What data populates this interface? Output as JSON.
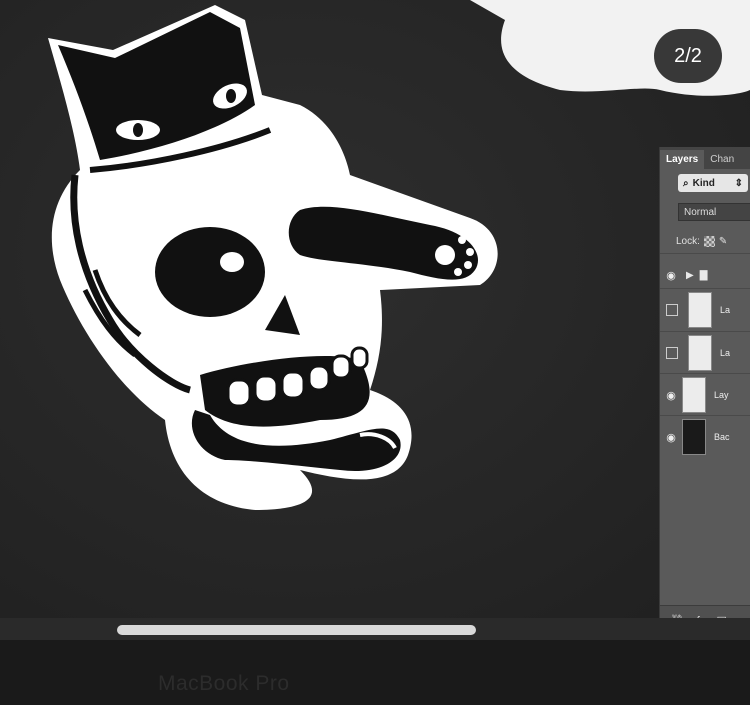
{
  "page_indicator": "2/2",
  "layers_panel": {
    "tabs": [
      "Layers",
      "Chan"
    ],
    "filter_label": "Kind",
    "blend_mode": "Normal",
    "lock_label": "Lock:",
    "layers": [
      {
        "name": "",
        "type": "group",
        "visible": true
      },
      {
        "name": "La",
        "type": "sketch",
        "visible": false
      },
      {
        "name": "La",
        "type": "sketch",
        "visible": false
      },
      {
        "name": "Lay",
        "type": "blank",
        "visible": true
      },
      {
        "name": "Bac",
        "type": "background",
        "visible": true
      }
    ],
    "footer_icons": [
      "link-icon",
      "fx-icon",
      "mask-icon"
    ]
  },
  "laptop_label": "MacBook Pro",
  "icons": {
    "eye": "eye-icon",
    "folder": "folder-icon",
    "search": "search-icon"
  }
}
